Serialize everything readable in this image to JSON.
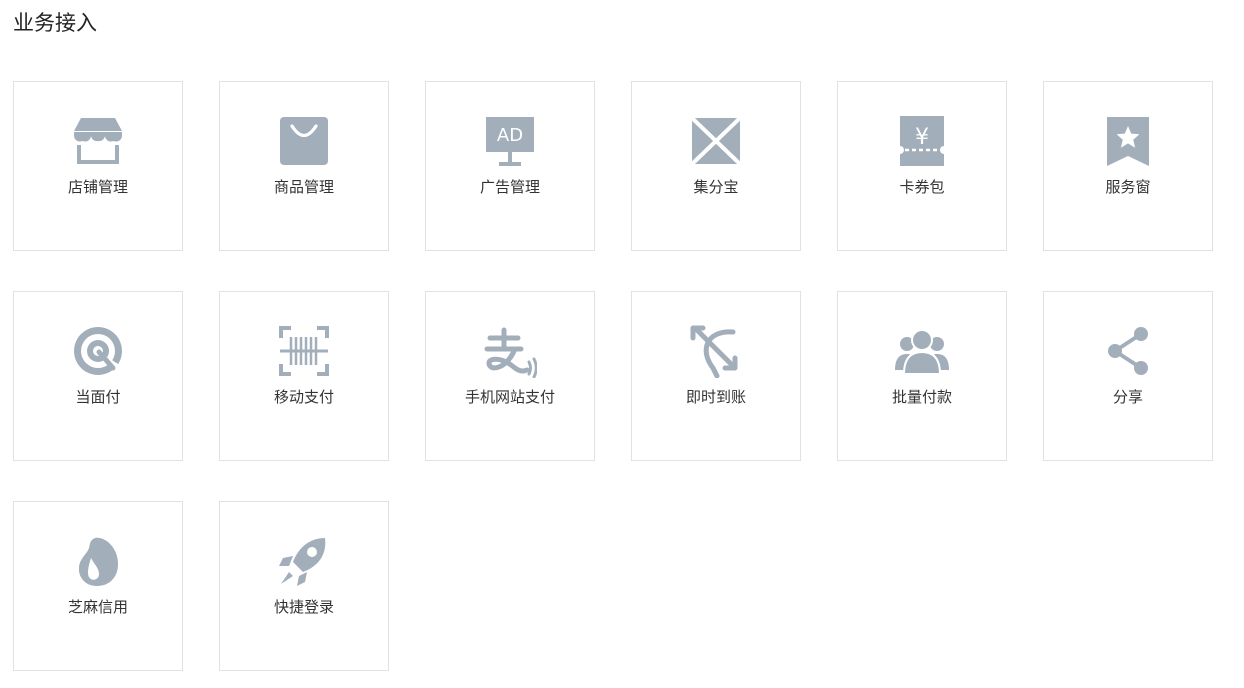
{
  "page": {
    "title": "业务接入"
  },
  "theme": {
    "icon_color": "#a3aebb",
    "border_color": "#e2e2e2"
  },
  "tiles": [
    {
      "label": "店铺管理",
      "icon": "storefront-icon"
    },
    {
      "label": "商品管理",
      "icon": "shopping-bag-icon"
    },
    {
      "label": "广告管理",
      "icon": "ad-display-icon",
      "icon_text": "AD"
    },
    {
      "label": "集分宝",
      "icon": "envelope-icon"
    },
    {
      "label": "卡券包",
      "icon": "coupon-ticket-icon",
      "icon_text": "¥"
    },
    {
      "label": "服务窗",
      "icon": "bookmark-star-icon"
    },
    {
      "label": "当面付",
      "icon": "touch-target-icon"
    },
    {
      "label": "移动支付",
      "icon": "barcode-scan-icon"
    },
    {
      "label": "手机网站支付",
      "icon": "alipay-script-icon"
    },
    {
      "label": "即时到账",
      "icon": "arrow-bow-icon"
    },
    {
      "label": "批量付款",
      "icon": "user-group-icon"
    },
    {
      "label": "分享",
      "icon": "share-icon"
    },
    {
      "label": "芝麻信用",
      "icon": "sesame-drop-icon"
    },
    {
      "label": "快捷登录",
      "icon": "rocket-icon"
    }
  ]
}
